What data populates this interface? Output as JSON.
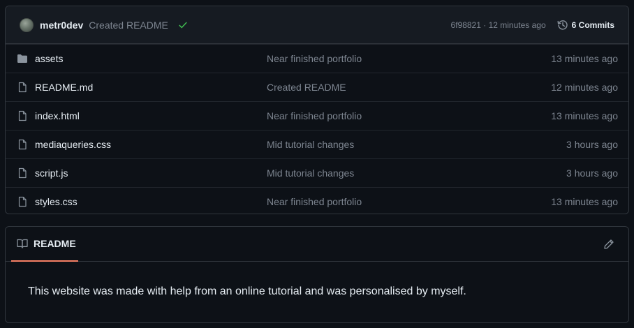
{
  "latest_commit": {
    "author": "metr0dev",
    "message": "Created README",
    "sha_time": "6f98821 · 12 minutes ago",
    "commits_label": "6 Commits",
    "check_color": "#3fb950"
  },
  "files": [
    {
      "name": "assets",
      "type": "folder",
      "commit": "Near finished portfolio",
      "time": "13 minutes ago"
    },
    {
      "name": "README.md",
      "type": "file",
      "commit": "Created README",
      "time": "12 minutes ago"
    },
    {
      "name": "index.html",
      "type": "file",
      "commit": "Near finished portfolio",
      "time": "13 minutes ago"
    },
    {
      "name": "mediaqueries.css",
      "type": "file",
      "commit": "Mid tutorial changes",
      "time": "3 hours ago"
    },
    {
      "name": "script.js",
      "type": "file",
      "commit": "Mid tutorial changes",
      "time": "3 hours ago"
    },
    {
      "name": "styles.css",
      "type": "file",
      "commit": "Near finished portfolio",
      "time": "13 minutes ago"
    }
  ],
  "readme": {
    "tab_label": "README",
    "body": "This website was made with help from an online tutorial and was personalised by myself.",
    "accent": "#f78166"
  }
}
